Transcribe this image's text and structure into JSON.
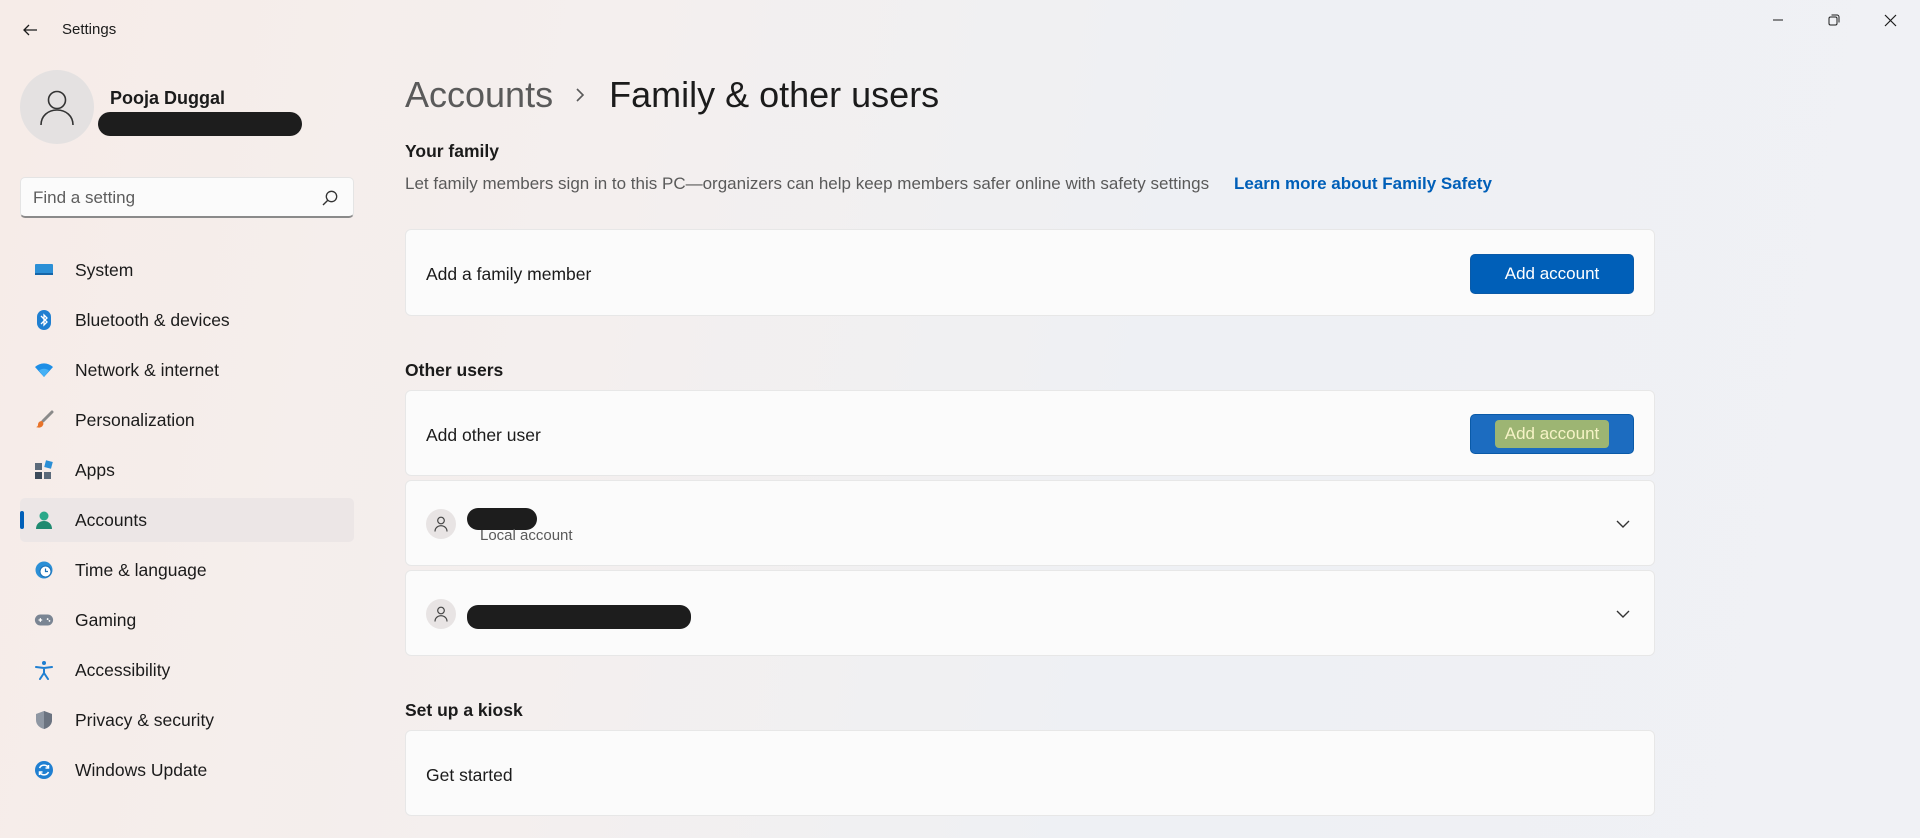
{
  "window": {
    "title": "Settings"
  },
  "profile": {
    "name": "Pooja Duggal"
  },
  "search": {
    "placeholder": "Find a setting"
  },
  "sidebar": {
    "items": [
      {
        "label": "System",
        "icon": "monitor-icon"
      },
      {
        "label": "Bluetooth & devices",
        "icon": "bluetooth-icon"
      },
      {
        "label": "Network & internet",
        "icon": "wifi-icon"
      },
      {
        "label": "Personalization",
        "icon": "brush-icon"
      },
      {
        "label": "Apps",
        "icon": "apps-icon"
      },
      {
        "label": "Accounts",
        "icon": "person-icon",
        "selected": true
      },
      {
        "label": "Time & language",
        "icon": "globe-clock-icon"
      },
      {
        "label": "Gaming",
        "icon": "gamepad-icon"
      },
      {
        "label": "Accessibility",
        "icon": "accessibility-icon"
      },
      {
        "label": "Privacy & security",
        "icon": "shield-icon"
      },
      {
        "label": "Windows Update",
        "icon": "refresh-icon"
      }
    ]
  },
  "breadcrumb": {
    "parent": "Accounts",
    "current": "Family & other users"
  },
  "family": {
    "title": "Your family",
    "description": "Let family members sign in to this PC—organizers can help keep members safer online with safety settings",
    "link": "Learn more about Family Safety",
    "add_member_label": "Add a family member",
    "add_button": "Add account"
  },
  "other_users": {
    "title": "Other users",
    "add_user_label": "Add other user",
    "add_button": "Add account",
    "users": [
      {
        "type": "Local account"
      },
      {
        "type": ""
      }
    ]
  },
  "kiosk": {
    "title": "Set up a kiosk",
    "get_started_label": "Get started"
  },
  "colors": {
    "accent": "#005fb8",
    "selected_nav": "#ece6e6"
  }
}
